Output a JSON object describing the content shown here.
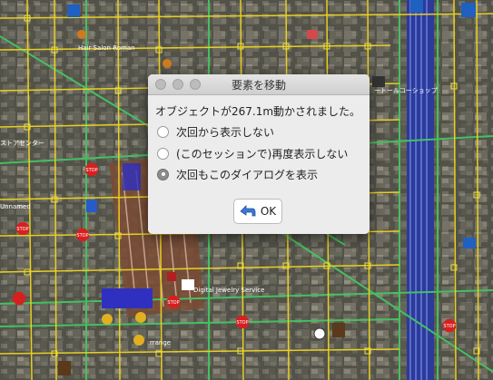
{
  "dialog": {
    "title": "要素を移動",
    "message": "オブジェクトが267.1m動かされました。",
    "options": [
      {
        "label": "次回から表示しない",
        "selected": false
      },
      {
        "label": "(このセッションで)再度表示しない",
        "selected": false
      },
      {
        "label": "次回もこのダイアログを表示",
        "selected": true
      }
    ],
    "ok_label": "OK",
    "ok_icon": "back-arrow-icon"
  },
  "map_labels": {
    "hair_salon": "Hair Salon Roman",
    "jewelry": "Digital Jewelry Service",
    "stop": "STOP",
    "store_center": "ストアセンター",
    "store_right": "ートールコーショップ",
    "arrange": "rrange",
    "unnamed": "Unnamed"
  },
  "colors": {
    "road_yellow": "#e8d020",
    "way_green": "#44c060",
    "rail_blue": "#3040d8",
    "stop_red": "#d62020"
  }
}
